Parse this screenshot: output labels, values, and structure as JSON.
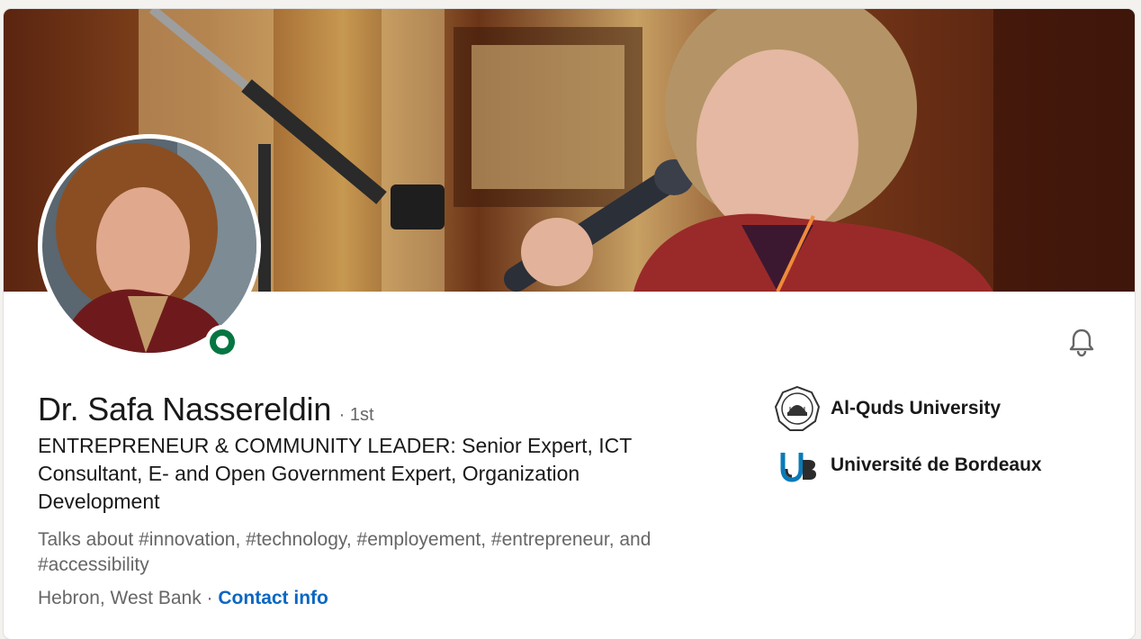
{
  "profile": {
    "name": "Dr. Safa Nassereldin",
    "degree": "· 1st",
    "headline": "ENTREPRENEUR & COMMUNITY LEADER: Senior Expert, ICT Consultant, E- and Open Government Expert, Organization Development",
    "talks_about": "Talks about #innovation, #technology, #employement, #entrepreneur, and #accessibility",
    "location": "Hebron, West Bank",
    "separator": " · ",
    "contact_label": "Contact info",
    "status": "online",
    "status_color": "#057642"
  },
  "education": [
    {
      "name": "Al-Quds University",
      "logo": "al-quds-university-seal"
    },
    {
      "name": "Université de Bordeaux",
      "logo_text": "UB"
    }
  ],
  "icons": {
    "notification": "bell-icon"
  },
  "colors": {
    "link": "#0a66c2",
    "text_primary": "#191919",
    "text_secondary": "#666666"
  }
}
